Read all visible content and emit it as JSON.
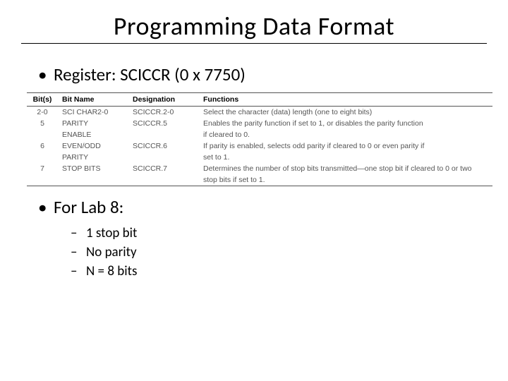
{
  "title": "Programming Data Format",
  "bullets": {
    "register": "Register: SCICCR (0 x 7750)",
    "forlab": "For Lab 8:",
    "sub": {
      "stop": "1 stop bit",
      "parity": "No parity",
      "nbits": "N = 8 bits"
    }
  },
  "table": {
    "headers": {
      "bits": "Bit(s)",
      "name": "Bit Name",
      "desig": "Designation",
      "func": "Functions"
    },
    "rows": [
      {
        "bits": "2-0",
        "name": "SCI CHAR2-0",
        "desig": "SCICCR.2-0",
        "func": "Select the character (data) length (one to eight bits)"
      },
      {
        "bits": "5",
        "name": "PARITY",
        "desig": "SCICCR.5",
        "func": "Enables the parity function if set to 1, or disables the parity function"
      },
      {
        "bits": "",
        "name": "ENABLE",
        "desig": "",
        "func": "if cleared to 0."
      },
      {
        "bits": "6",
        "name": "EVEN/ODD",
        "desig": "SCICCR.6",
        "func": "If parity is enabled, selects odd parity if cleared to 0 or even parity if"
      },
      {
        "bits": "",
        "name": "PARITY",
        "desig": "",
        "func": "set to 1."
      },
      {
        "bits": "7",
        "name": "STOP BITS",
        "desig": "SCICCR.7",
        "func": "Determines the number of stop bits transmitted—one stop bit if cleared to 0 or two"
      },
      {
        "bits": "",
        "name": "",
        "desig": "",
        "func": "stop bits if set to 1."
      }
    ]
  }
}
